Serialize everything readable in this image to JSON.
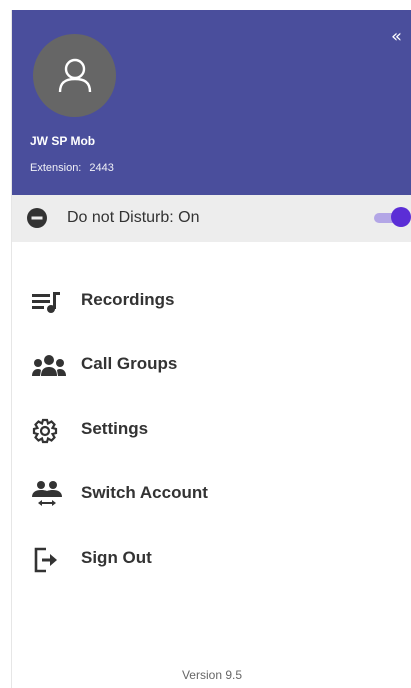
{
  "header": {
    "collapse_icon": "«",
    "user_name": "JW SP Mob",
    "extension_label": "Extension:",
    "extension_value": "2443",
    "background": "#4a4e9c"
  },
  "dnd": {
    "label": "Do not Disturb:",
    "state": "On",
    "enabled": true,
    "accent": "#5b2ed6"
  },
  "menu": {
    "items": [
      {
        "label": "Recordings",
        "icon": "recordings-icon"
      },
      {
        "label": "Call Groups",
        "icon": "call-groups-icon"
      },
      {
        "label": "Settings",
        "icon": "gear-icon"
      },
      {
        "label": "Switch Account",
        "icon": "switch-account-icon"
      },
      {
        "label": "Sign Out",
        "icon": "sign-out-icon"
      }
    ]
  },
  "footer": {
    "version": "Version 9.5"
  }
}
